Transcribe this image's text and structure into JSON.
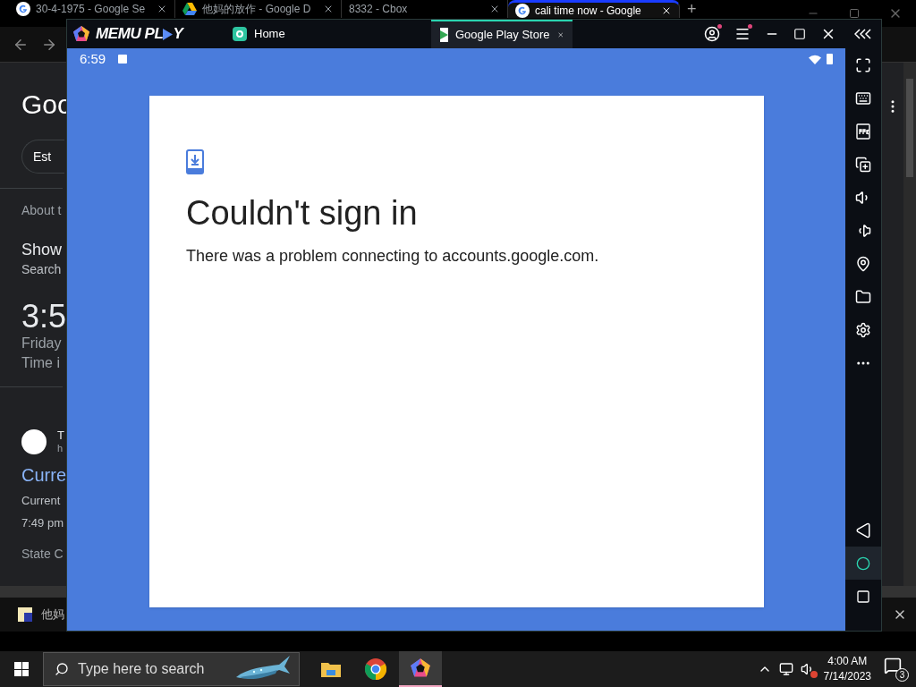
{
  "browser": {
    "tabs": [
      {
        "title": "30-4-1975 - Google Se",
        "selected": false
      },
      {
        "title": "他妈的放作 - Google D",
        "selected": false
      },
      {
        "title": "8332 - Cbox",
        "selected": false
      },
      {
        "title": "cali time now - Google",
        "selected": true
      }
    ],
    "new_tab": "+",
    "page": [
      {
        "kind": "logo",
        "text": "Goo"
      },
      {
        "kind": "chip",
        "text": "Est"
      },
      {
        "kind": "rule"
      },
      {
        "kind": "note",
        "text": "About t"
      },
      {
        "kind": "heading",
        "text": "Show"
      },
      {
        "kind": "sub",
        "text": "Search"
      },
      {
        "kind": "clock",
        "text": "3:5"
      },
      {
        "kind": "line",
        "text": "Friday"
      },
      {
        "kind": "line",
        "text": "Time i"
      },
      {
        "kind": "rule"
      },
      {
        "kind": "source",
        "text": "T",
        "subtext": "h"
      },
      {
        "kind": "link",
        "text": "Curre"
      },
      {
        "kind": "small",
        "text": "Current"
      },
      {
        "kind": "small",
        "text": "7:49 pm"
      },
      {
        "kind": "note",
        "text": "State C"
      }
    ],
    "download": {
      "text": "他妈"
    }
  },
  "emulator": {
    "logo": {
      "left": "MEMU PL",
      "right": "Y"
    },
    "tabs": [
      {
        "label": "Home",
        "selected": false
      },
      {
        "label": "Google Play Store",
        "selected": true
      }
    ],
    "status_bar": {
      "time": "6:59"
    },
    "dialog": {
      "title": "Couldn't sign in",
      "message": "There was a problem connecting to accounts.google.com."
    },
    "nav": [
      {
        "selected": false
      },
      {
        "selected": true
      },
      {
        "selected": false
      }
    ]
  },
  "taskbar": {
    "search": {
      "placeholder": "Type here to search"
    },
    "apps": [
      {
        "selected": false
      },
      {
        "selected": false
      },
      {
        "selected": true
      }
    ],
    "time": "4:00 AM",
    "date": "7/14/2023",
    "notifications": "3"
  }
}
